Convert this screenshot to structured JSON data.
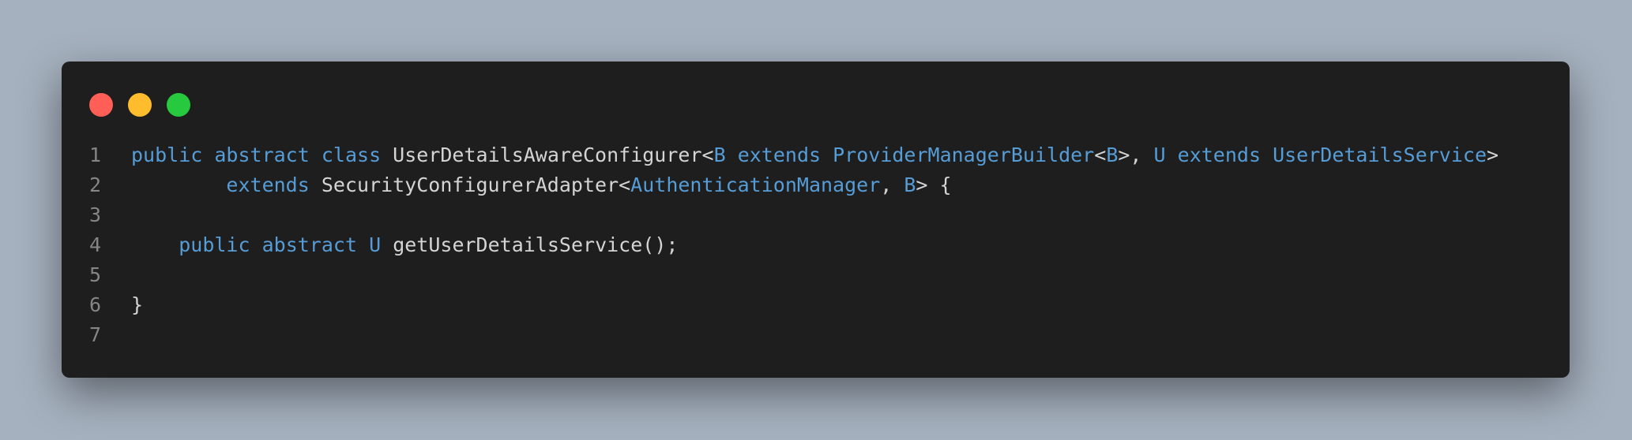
{
  "colors": {
    "background": "#a6b1bf",
    "editor": "#1e1e1e",
    "keyword": "#569cd6",
    "text": "#d4d4d4",
    "line_number": "#858585",
    "dot_red": "#ff5f56",
    "dot_yellow": "#ffbd2e",
    "dot_green": "#27c93f"
  },
  "window_controls": [
    "close",
    "minimize",
    "maximize"
  ],
  "code": {
    "lines": [
      {
        "n": "1",
        "tokens": [
          {
            "t": "public",
            "k": "kw"
          },
          {
            "t": " ",
            "k": "pl"
          },
          {
            "t": "abstract",
            "k": "kw"
          },
          {
            "t": " ",
            "k": "pl"
          },
          {
            "t": "class",
            "k": "kw"
          },
          {
            "t": " UserDetailsAwareConfigurer<",
            "k": "pl"
          },
          {
            "t": "B",
            "k": "ty"
          },
          {
            "t": " ",
            "k": "pl"
          },
          {
            "t": "extends",
            "k": "kw"
          },
          {
            "t": " ",
            "k": "pl"
          },
          {
            "t": "ProviderManagerBuilder",
            "k": "ty"
          },
          {
            "t": "<",
            "k": "pl"
          },
          {
            "t": "B",
            "k": "ty"
          },
          {
            "t": ">, ",
            "k": "pl"
          },
          {
            "t": "U",
            "k": "ty"
          },
          {
            "t": " ",
            "k": "pl"
          },
          {
            "t": "extends",
            "k": "kw"
          },
          {
            "t": " ",
            "k": "pl"
          },
          {
            "t": "UserDetailsService",
            "k": "ty"
          },
          {
            "t": ">",
            "k": "pl"
          }
        ]
      },
      {
        "n": "2",
        "tokens": [
          {
            "t": "        ",
            "k": "pl"
          },
          {
            "t": "extends",
            "k": "kw"
          },
          {
            "t": " SecurityConfigurerAdapter<",
            "k": "pl"
          },
          {
            "t": "AuthenticationManager",
            "k": "ty"
          },
          {
            "t": ", ",
            "k": "pl"
          },
          {
            "t": "B",
            "k": "ty"
          },
          {
            "t": "> {",
            "k": "pl"
          }
        ]
      },
      {
        "n": "3",
        "tokens": []
      },
      {
        "n": "4",
        "tokens": [
          {
            "t": "    ",
            "k": "pl"
          },
          {
            "t": "public",
            "k": "kw"
          },
          {
            "t": " ",
            "k": "pl"
          },
          {
            "t": "abstract",
            "k": "kw"
          },
          {
            "t": " ",
            "k": "pl"
          },
          {
            "t": "U",
            "k": "ty"
          },
          {
            "t": " getUserDetailsService();",
            "k": "pl"
          }
        ]
      },
      {
        "n": "5",
        "tokens": []
      },
      {
        "n": "6",
        "tokens": [
          {
            "t": "}",
            "k": "pl"
          }
        ]
      },
      {
        "n": "7",
        "tokens": []
      }
    ]
  }
}
